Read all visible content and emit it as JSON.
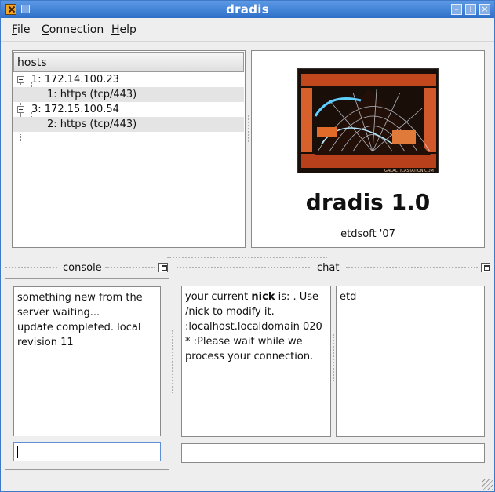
{
  "window": {
    "title": "dradis"
  },
  "menu": {
    "file": "File",
    "connection": "Connection",
    "help": "Help"
  },
  "hosts": {
    "header": "hosts",
    "rows": [
      {
        "label": "1: 172.14.100.23"
      },
      {
        "label": "1: https (tcp/443)"
      },
      {
        "label": "3: 172.15.100.54"
      },
      {
        "label": "2: https (tcp/443)"
      }
    ]
  },
  "about": {
    "title": "dradis 1.0",
    "subtitle": "etdsoft '07",
    "splash_credit": "GALACTICASTATION.COM"
  },
  "console": {
    "title": "console",
    "lines": [
      "something new from the",
      "server waiting...",
      "update completed. local",
      "revision 11"
    ],
    "input_value": ""
  },
  "chat": {
    "title": "chat",
    "message_prefix": "your current ",
    "message_bold": "nick",
    "message_suffix": " is: . Use",
    "lines": [
      "/nick to modify it.",
      ":localhost.localdomain 020",
      "* :Please wait while we",
      "process your connection."
    ],
    "users": [
      "etd"
    ],
    "input_value": ""
  },
  "colors": {
    "titlebar": "#3f7fd4",
    "selection": "#e4e4e4",
    "accent": "#5f8fd6"
  }
}
